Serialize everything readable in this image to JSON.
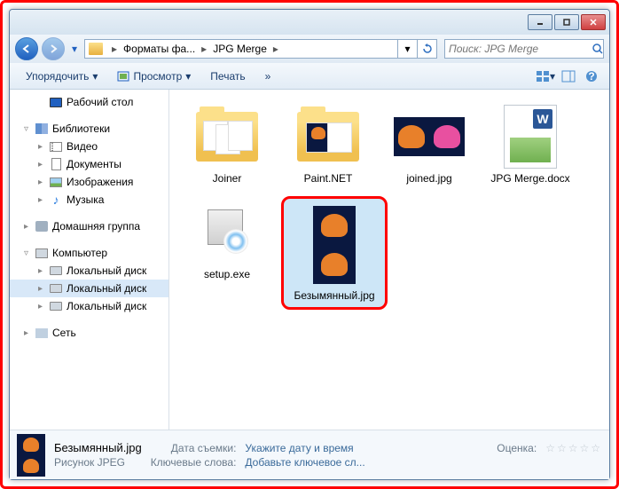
{
  "navbar": {
    "breadcrumbs": [
      "Форматы фа...",
      "JPG Merge"
    ],
    "search_placeholder": "Поиск: JPG Merge"
  },
  "toolbar": {
    "organize": "Упорядочить",
    "preview": "Просмотр",
    "print": "Печать"
  },
  "sidebar": {
    "desktop": "Рабочий стол",
    "libraries": "Библиотеки",
    "video": "Видео",
    "documents": "Документы",
    "images": "Изображения",
    "music": "Музыка",
    "homegroup": "Домашняя группа",
    "computer": "Компьютер",
    "local_disk1": "Локальный диск",
    "local_disk2": "Локальный диск",
    "local_disk3": "Локальный диск",
    "network": "Сеть"
  },
  "files": {
    "joiner": "Joiner",
    "paintnet": "Paint.NET",
    "joined": "joined.jpg",
    "jpgmerge": "JPG Merge.docx",
    "setup": "setup.exe",
    "bez": "Безымянный.jpg"
  },
  "details": {
    "name": "Безымянный.jpg",
    "type": "Рисунок JPEG",
    "date_label": "Дата съемки:",
    "date_value": "Укажите дату и время",
    "keywords_label": "Ключевые слова:",
    "keywords_value": "Добавьте ключевое сл...",
    "rating_label": "Оценка:"
  }
}
